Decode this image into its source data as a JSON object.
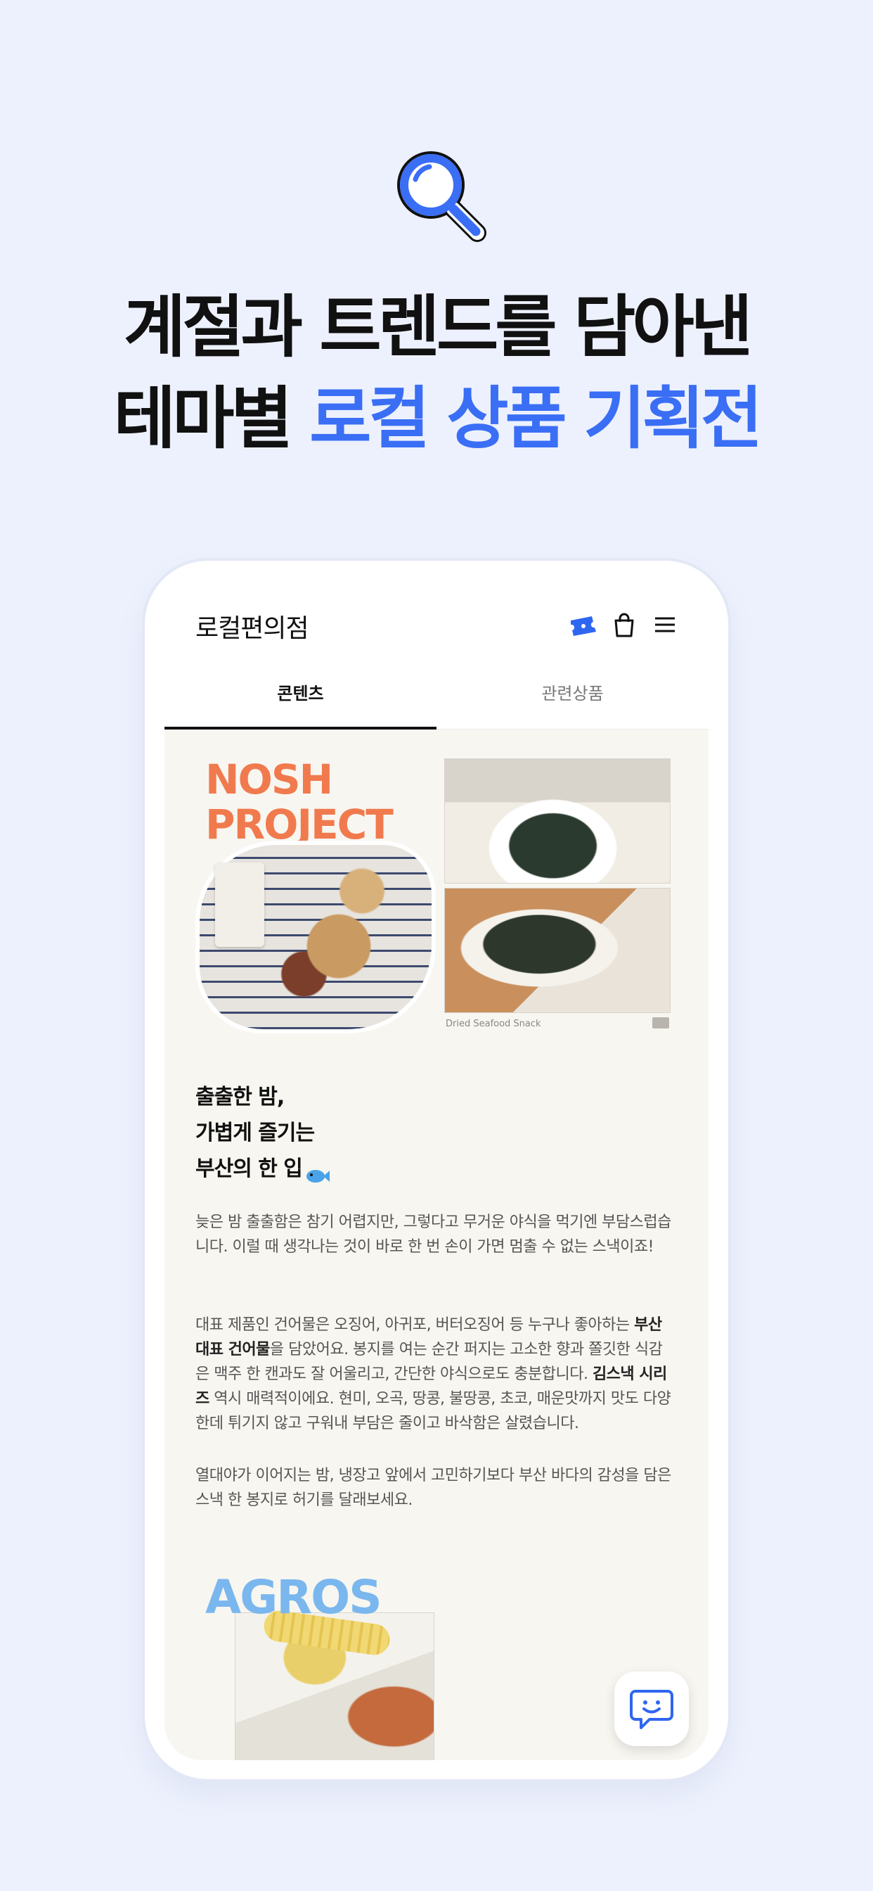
{
  "headline": {
    "line1": "계절과 트렌드를 담아낸",
    "line2_plain": "테마별",
    "line2_accent": "로컬 상품 기획전",
    "accent_color": "#3a6ef5"
  },
  "hero_icon": "search-icon",
  "app": {
    "logo": "로컬편의점",
    "header_icons": [
      "ticket-icon",
      "shopping-bag-icon",
      "menu-icon"
    ],
    "tabs": [
      {
        "label": "콘텐츠",
        "active": true
      },
      {
        "label": "관련상품",
        "active": false
      }
    ]
  },
  "nosh": {
    "title_line1": "NOSH",
    "title_line2": "PROJECT",
    "caption": "Dried Seafood Snack",
    "title_color": "#f07a4e"
  },
  "article": {
    "title_lines": [
      "출출한 밤,",
      "가볍게 즐기는",
      "부산의 한 입"
    ],
    "title_emoji_icon": "fish-icon",
    "p1": "늦은 밤 출출함은 참기 어렵지만, 그렇다고 무거운 야식을 먹기엔 부담스럽습니다. 이럴 때 생각나는 것이 바로 한 번 손이 가면 멈출 수 없는 스낵이죠!",
    "p2_a": "대표 제품인 건어물은 오징어, 아귀포, 버터오징어 등 누구나 좋아하는 ",
    "p2_b": "부산 대표 건어물",
    "p2_c": "을 담았어요. 봉지를 여는 순간 퍼지는 고소한 향과 쫄깃한 식감은 맥주 한 캔과도 잘 어울리고, 간단한 야식으로도 충분합니다. ",
    "p2_d": "김스낵 시리즈",
    "p2_e": " 역시 매력적이에요. 현미, 오곡, 땅콩, 불땅콩, 초코, 매운맛까지 맛도 다양한데 튀기지 않고 구워내 부담은 줄이고 바삭함은 살렸습니다.",
    "p3": "열대야가 이어지는 밤, 냉장고 앞에서 고민하기보다 부산 바다의 감성을 담은 스낵 한 봉지로 허기를 달래보세요."
  },
  "agros": {
    "title": "AGROS",
    "title_color": "#7ab7ee"
  },
  "chat_button_icon": "chat-bot-icon"
}
